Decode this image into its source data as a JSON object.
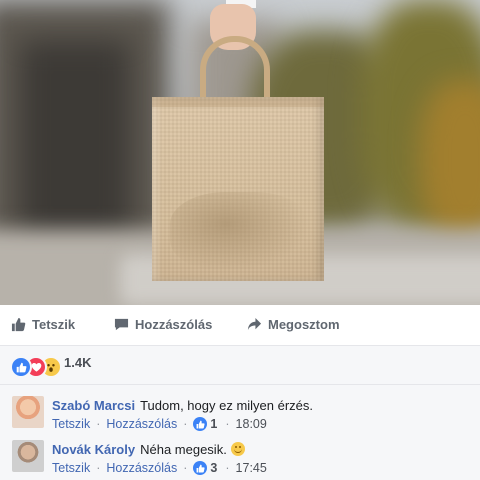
{
  "post": {
    "actions": {
      "like_label": "Tetszik",
      "comment_label": "Hozzászólás",
      "share_label": "Megosztom"
    },
    "reactions": {
      "icons": [
        "like-icon",
        "love-icon",
        "wow-icon"
      ],
      "count": "1.4K"
    },
    "comments": [
      {
        "author": "Szabó Marcsi",
        "text": "Tudom, hogy ez milyen érzés.",
        "like_label": "Tetszik",
        "reply_label": "Hozzászólás",
        "likes": "1",
        "time": "18:09"
      },
      {
        "author": "Novák Károly",
        "text": "Néha megesik.",
        "emoji": "smile-emoji",
        "like_label": "Tetszik",
        "reply_label": "Hozzászólás",
        "likes": "3",
        "time": "17:45"
      }
    ]
  },
  "colors": {
    "link_blue": "#4267b2",
    "like_blue": "#3b82f6",
    "love_red": "#f33e58",
    "wow_yellow": "#f7c94a",
    "action_gray": "#606770",
    "panel_bg": "#f6f7f9"
  }
}
